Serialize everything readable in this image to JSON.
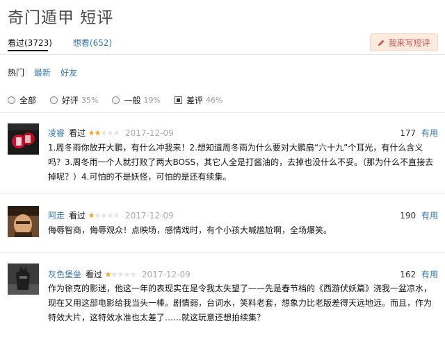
{
  "page_title": "奇门遁甲 短评",
  "tabs": [
    {
      "label": "看过(3723)",
      "active": true
    },
    {
      "label": "想看(652)",
      "active": false
    }
  ],
  "write_button": "我来写短评",
  "sort": [
    "热门",
    "最新",
    "好友"
  ],
  "filters": [
    {
      "label": "全部",
      "pct": "",
      "checked": false
    },
    {
      "label": "好评",
      "pct": "35%",
      "checked": false
    },
    {
      "label": "一般",
      "pct": "19%",
      "checked": false
    },
    {
      "label": "差评",
      "pct": "46%",
      "checked": true
    }
  ],
  "comments": [
    {
      "user": "凌睿",
      "status": "看过",
      "rating": 2,
      "date": "2017-12-09",
      "votes": "177",
      "useful": "有用",
      "text": "1.周冬雨你放开大鹏，有什么冲我来！2.想知道周冬雨为什么要对大鹏扇“六十九”个耳光，有什么含义吗？3.周冬雨一个人就打败了两大BOSS，其它人全是打酱油的，去掉也没什么不妥。（那为什么不直接去掉呢？）4.可怕的不是妖怪，可怕的是还有续集。"
    },
    {
      "user": "阿走",
      "status": "看过",
      "rating": 1,
      "date": "2017-12-09",
      "votes": "190",
      "useful": "有用",
      "text": "侮辱智商，侮辱观众！点映场，感情戏时，有个小孩大喊尴尬啊，全场爆笑。"
    },
    {
      "user": "灰色堡垒",
      "status": "看过",
      "rating": 1,
      "date": "2017-12-09",
      "votes": "162",
      "useful": "有用",
      "text": "作为徐克的影迷，他这一年的表现实在是令我太失望了——先是春节档的《西游伏妖篇》浇我一盆凉水，现在又用这部电影给我当头一棒。剧情弱，台词水，笑料老套，想象力比老版差得天远地远。而且，作为特效大片，这特效水准也太差了……就这玩意还想拍续集？"
    }
  ],
  "colors": {
    "link": "#3377aa",
    "star": "#f5a623",
    "accent_btn_bg": "#fbeade"
  }
}
